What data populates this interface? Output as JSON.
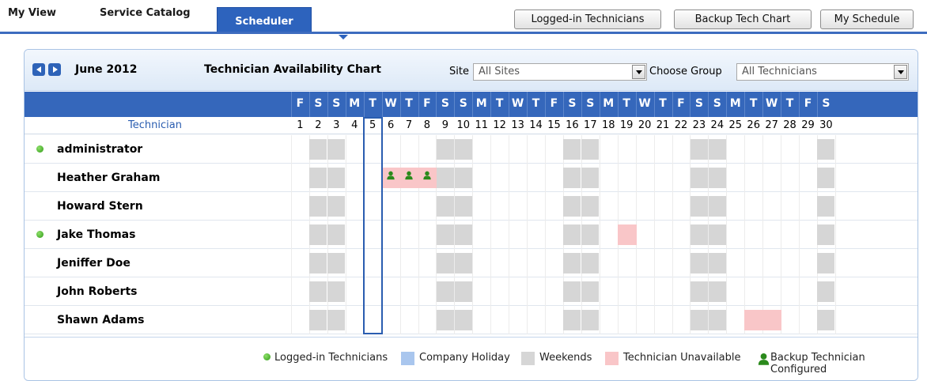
{
  "nav": {
    "tabs": [
      {
        "label": "My View"
      },
      {
        "label": "Service Catalog"
      },
      {
        "label": "Scheduler"
      }
    ],
    "buttons": [
      {
        "label": "Logged-in Technicians"
      },
      {
        "label": "Backup Tech Chart"
      },
      {
        "label": "My Schedule"
      }
    ]
  },
  "header": {
    "month": "June 2012",
    "title": "Technician Availability Chart",
    "site_label": "Site",
    "site_value": "All Sites",
    "group_label": "Choose Group",
    "group_value": "All Technicians"
  },
  "grid": {
    "technician_header": "Technician",
    "days_of_week": [
      "F",
      "S",
      "S",
      "M",
      "T",
      "W",
      "T",
      "F",
      "S",
      "S",
      "M",
      "T",
      "W",
      "T",
      "F",
      "S",
      "S",
      "M",
      "T",
      "W",
      "T",
      "F",
      "S",
      "S",
      "M",
      "T",
      "W",
      "T",
      "F",
      "S"
    ],
    "day_numbers": [
      "1",
      "2",
      "3",
      "4",
      "5",
      "6",
      "7",
      "8",
      "9",
      "10",
      "11",
      "12",
      "13",
      "14",
      "15",
      "16",
      "17",
      "18",
      "19",
      "20",
      "21",
      "22",
      "23",
      "24",
      "25",
      "26",
      "27",
      "28",
      "29",
      "30"
    ],
    "today": 5,
    "weekend_days": [
      2,
      3,
      9,
      10,
      16,
      17,
      23,
      24,
      30
    ],
    "technicians": [
      {
        "name": "administrator",
        "logged_in": true,
        "unavailable": [],
        "backup": []
      },
      {
        "name": "Heather Graham",
        "logged_in": false,
        "unavailable": [
          6,
          7,
          8
        ],
        "backup": [
          6,
          7,
          8
        ]
      },
      {
        "name": "Howard Stern",
        "logged_in": false,
        "unavailable": [],
        "backup": []
      },
      {
        "name": "Jake Thomas",
        "logged_in": true,
        "unavailable": [
          19
        ],
        "backup": []
      },
      {
        "name": "Jeniffer Doe",
        "logged_in": false,
        "unavailable": [],
        "backup": []
      },
      {
        "name": "John Roberts",
        "logged_in": false,
        "unavailable": [],
        "backup": []
      },
      {
        "name": "Shawn Adams",
        "logged_in": false,
        "unavailable": [
          26,
          27
        ],
        "backup": []
      }
    ]
  },
  "legend": {
    "logged_in": "Logged-in Technicians",
    "holiday": "Company Holiday",
    "weekends": "Weekends",
    "unavailable": "Technician Unavailable",
    "backup": "Backup Technician Configured"
  },
  "colors": {
    "accent": "#3567bb",
    "weekend": "#d6d6d6",
    "unavailable": "#f9c6c8",
    "holiday": "#a9c6ee",
    "logged_in": "#3ca01e"
  }
}
